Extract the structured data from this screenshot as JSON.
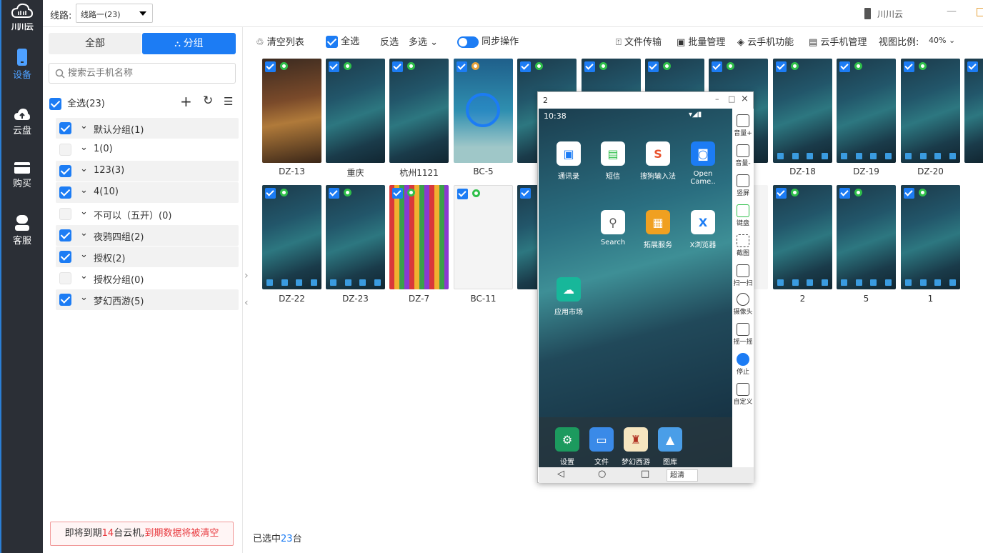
{
  "app": {
    "logo_text": "川川云",
    "window_title": "川川云"
  },
  "rail": [
    {
      "label": "设备",
      "icon": "phone-icon",
      "active": true
    },
    {
      "label": "云盘",
      "icon": "cloud-upload-icon"
    },
    {
      "label": "购买",
      "icon": "card-icon"
    },
    {
      "label": "客服",
      "icon": "headset-icon"
    }
  ],
  "topbar": {
    "line_label": "线路:",
    "line_value": "线路一(23)"
  },
  "sidepanel": {
    "tabs": [
      "全部",
      "分组"
    ],
    "search_placeholder": "搜索云手机名称",
    "select_all": "全选(23)",
    "groups": [
      {
        "label": "默认分组(1)",
        "checked": true
      },
      {
        "label": "1(0)",
        "checked": false
      },
      {
        "label": "123(3)",
        "checked": true
      },
      {
        "label": "4(10)",
        "checked": true
      },
      {
        "label": "不可以（五开）(0)",
        "checked": false
      },
      {
        "label": "夜鸦四组(2)",
        "checked": true
      },
      {
        "label": "授权(2)",
        "checked": true
      },
      {
        "label": "授权分组(0)",
        "checked": false
      },
      {
        "label": "梦幻西游(5)",
        "checked": true
      }
    ],
    "warning": {
      "prefix": "即将到期",
      "count": "14",
      "mid": "台云机,",
      "tail": "到期数据将被清空"
    }
  },
  "toolbar": {
    "clear_list": "清空列表",
    "select_all": "全选",
    "invert": "反选",
    "multi": "多选",
    "sync": "同步操作",
    "file_transfer": "文件传输",
    "batch_manage": "批量管理",
    "phone_features": "云手机功能",
    "phone_manage": "云手机管理",
    "view_ratio": "视图比例:",
    "ratio_value": "40%"
  },
  "devices_row1": [
    "DZ-13",
    "重庆",
    "杭州1121",
    "BC-5",
    "",
    "",
    "",
    "",
    "DZ-18",
    "DZ-19",
    "DZ-20"
  ],
  "devices_row2": [
    "DZ-22",
    "DZ-23",
    "DZ-7",
    "BC-11",
    "",
    "",
    "",
    "",
    "2",
    "5",
    "1"
  ],
  "phone_window": {
    "title": "2",
    "time": "10:38",
    "apps_row1": [
      "通讯录",
      "短信",
      "搜狗输入法",
      "Open Came.."
    ],
    "apps_row2": [
      "Search",
      "拓展服务",
      "X浏览器"
    ],
    "apps_row3": [
      "应用市场"
    ],
    "dock": [
      "设置",
      "文件",
      "梦幻西游",
      "图库"
    ],
    "quality": "超清",
    "tools": [
      "音量+",
      "音量-",
      "竖屏",
      "键盘",
      "截图",
      "扫一扫",
      "摄像头",
      "摇一摇",
      "停止",
      "自定义"
    ]
  },
  "footer": {
    "selected_prefix": "已选中",
    "selected_count": "23",
    "selected_suffix": "台"
  },
  "colors": {
    "accent": "#1c7cf4",
    "rail_bg": "#2b2f36",
    "warn_red": "#e8383d"
  }
}
